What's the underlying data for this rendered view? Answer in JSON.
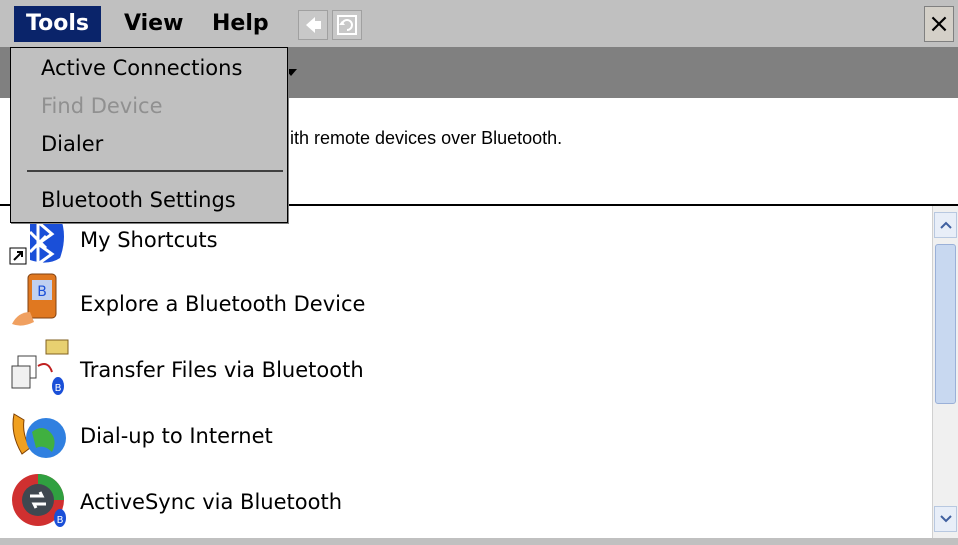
{
  "menubar": {
    "items": [
      {
        "label": "Tools",
        "active": true
      },
      {
        "label": "View",
        "active": false
      },
      {
        "label": "Help",
        "active": false
      }
    ],
    "close_label": "×"
  },
  "tools_menu": {
    "items": [
      {
        "label": "Active Connections",
        "disabled": false
      },
      {
        "label": "Find Device",
        "disabled": true
      },
      {
        "label": "Dialer",
        "disabled": false
      },
      {
        "label": "Bluetooth Settings",
        "disabled": false
      }
    ]
  },
  "description": "ith remote devices over Bluetooth.",
  "list": {
    "items": [
      {
        "label": "My Shortcuts",
        "icon": "bluetooth-shortcut-icon"
      },
      {
        "label": "Explore a Bluetooth Device",
        "icon": "phone-bluetooth-icon"
      },
      {
        "label": "Transfer Files via Bluetooth",
        "icon": "file-transfer-icon"
      },
      {
        "label": "Dial-up to Internet",
        "icon": "dialup-globe-icon"
      },
      {
        "label": "ActiveSync via Bluetooth",
        "icon": "activesync-icon"
      }
    ]
  }
}
